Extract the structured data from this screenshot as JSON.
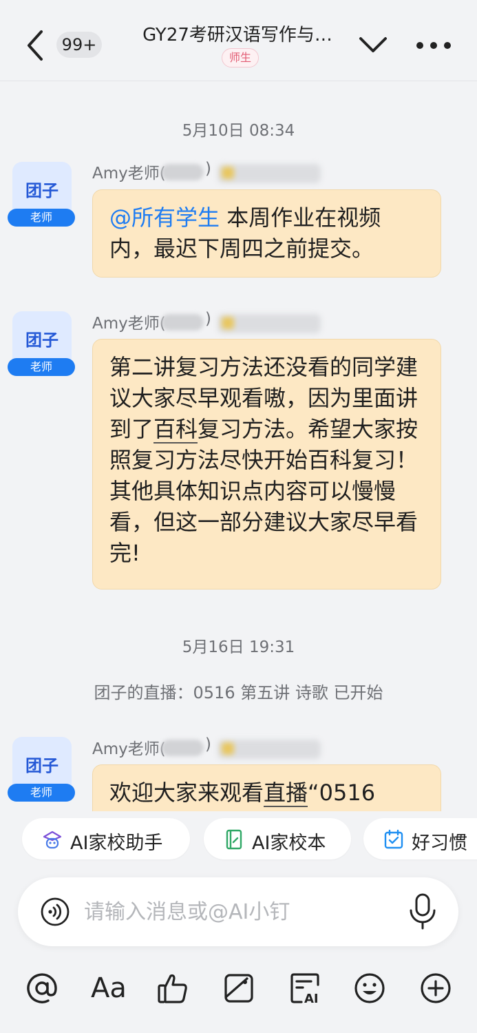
{
  "header": {
    "unread_count": "99+",
    "title": "GY27考研汉语写作与…",
    "role_tag": "师生"
  },
  "messages": [
    {
      "timestamp": "5月10日 08:34",
      "avatar_name": "团子",
      "avatar_tag": "老师",
      "sender": "Amy老师(",
      "sender_close": ")",
      "mention": "@所有学生",
      "text": " 本周作业在视频内，最迟下周四之前提交。"
    },
    {
      "avatar_name": "团子",
      "avatar_tag": "老师",
      "sender": "Amy老师(",
      "sender_close": ")",
      "text_before": "第二讲复习方法还没看的同学建议大家尽早观看嗷，因为里面讲到了",
      "text_link": "百科",
      "text_after": "复习方法。希望大家按照复习方法尽快开始百科复习！其他具体知识点内容可以慢慢看，但这一部分建议大家尽早看完!"
    },
    {
      "timestamp": "5月16日 19:31",
      "system": "团子的直播：0516 第五讲 诗歌 已开始",
      "avatar_name": "团子",
      "avatar_tag": "老师",
      "sender": "Amy老师(",
      "sender_close": ")",
      "text_before": "欢迎大家来观看",
      "text_link": "直播",
      "text_after": "“0516"
    }
  ],
  "quick_actions": [
    {
      "label": "AI家校助手",
      "icon": "ai-robot-icon"
    },
    {
      "label": "AI家校本",
      "icon": "notebook-icon"
    },
    {
      "label": "好习惯",
      "icon": "calendar-check-icon"
    }
  ],
  "input": {
    "placeholder": "请输入消息或@AI小钉"
  },
  "toolbar": {
    "font_label": "Aa",
    "icons": [
      "at-icon",
      "font-icon",
      "thumbs-up-icon",
      "image-icon",
      "ai-doc-icon",
      "emoji-icon",
      "plus-icon"
    ]
  },
  "colors": {
    "bubble": "#fde8c4",
    "accent": "#1e7cf2",
    "avatar_bg": "#dfeaff",
    "role_tag": "#e25b72"
  }
}
